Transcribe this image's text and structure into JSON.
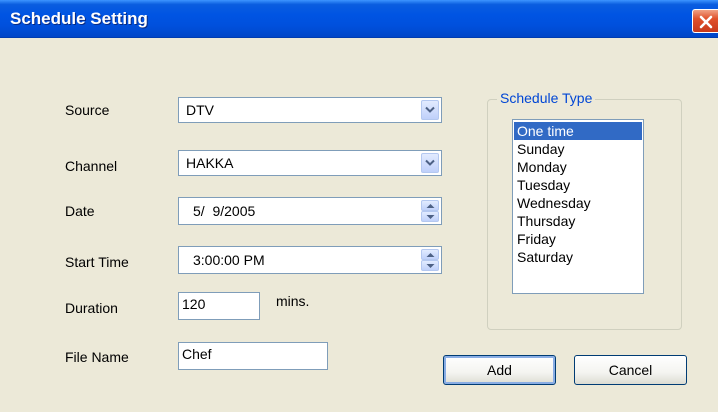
{
  "window": {
    "title": "Schedule Setting"
  },
  "form": {
    "source": {
      "label": "Source",
      "value": "DTV"
    },
    "channel": {
      "label": "Channel",
      "value": "HAKKA"
    },
    "date": {
      "label": "Date",
      "value": "5/  9/2005"
    },
    "start_time": {
      "label": "Start Time",
      "value": "3:00:00 PM"
    },
    "duration": {
      "label": "Duration",
      "value": "120",
      "unit": "mins."
    },
    "file_name": {
      "label": "File Name",
      "value": "Chef"
    }
  },
  "schedule_type": {
    "title": "Schedule Type",
    "selected_index": 0,
    "items": [
      "One time",
      "Sunday",
      "Monday",
      "Tuesday",
      "Wednesday",
      "Thursday",
      "Friday",
      "Saturday"
    ]
  },
  "buttons": {
    "add": "Add",
    "cancel": "Cancel"
  },
  "icons": {
    "close": "close-icon",
    "dropdown": "chevron-down-icon",
    "spin_up": "spin-up-icon",
    "spin_down": "spin-down-icon"
  },
  "colors": {
    "titlebar": "#0054e3",
    "dialog_bg": "#ece9d8",
    "selection": "#316ac5",
    "group_title": "#0046d5",
    "close_button": "#e0512b"
  }
}
